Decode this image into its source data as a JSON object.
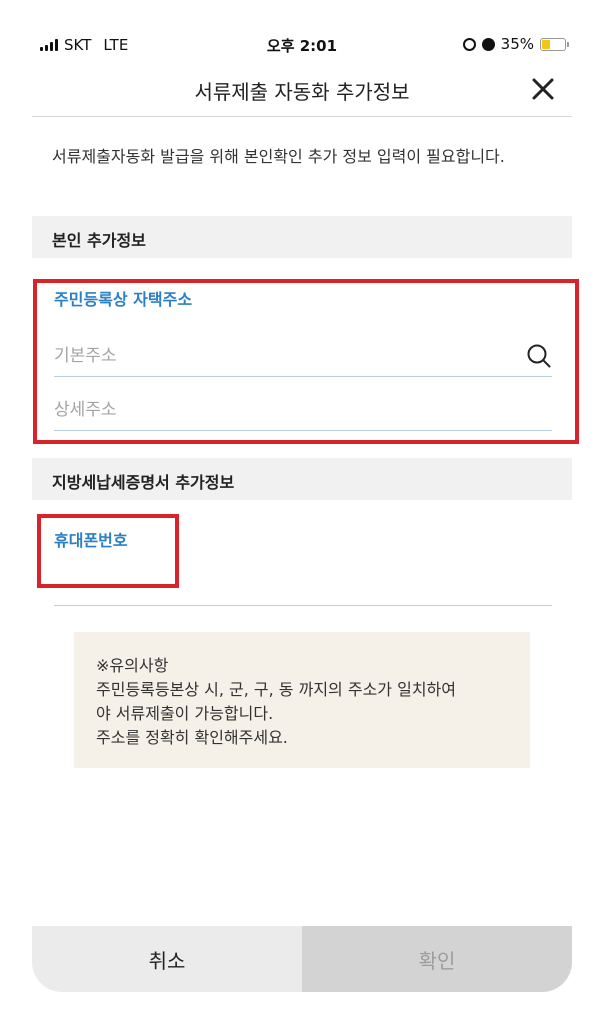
{
  "status_bar": {
    "carrier": "SKT",
    "network": "LTE",
    "time": "오후 2:01",
    "battery": "35%",
    "battery_level": 0.35
  },
  "header": {
    "title": "서류제출 자동화 추가정보",
    "close_icon": "close-icon"
  },
  "notice": "서류제출자동화 발급을 위해 본인확인 추가 정보 입력이 필요합니다.",
  "section1": {
    "title": "본인 추가정보",
    "field_label": "주민등록상 자택주소",
    "base_address_placeholder": "기본주소",
    "detail_address_placeholder": "상세주소"
  },
  "section2": {
    "title": "지방세납세증명서 추가정보",
    "phone_label": "휴대폰번호",
    "phone_placeholder": ""
  },
  "caution": {
    "lines": [
      "※유의사항",
      "주민등록등본상 시, 군, 구, 동 까지의 주소가 일치하여",
      "야 서류제출이 가능합니다.",
      "주소를 정확히 확인해주세요."
    ]
  },
  "buttons": {
    "cancel": "취소",
    "confirm": "확인"
  },
  "colors": {
    "accent": "#2b7fc4",
    "highlight": "#d9222a",
    "caution_bg": "#f5f1e8"
  }
}
